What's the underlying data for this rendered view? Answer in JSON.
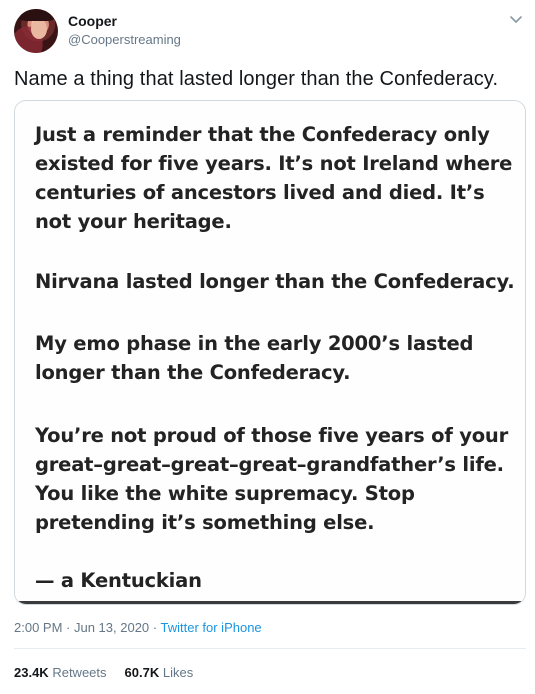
{
  "user": {
    "name": "Cooper",
    "handle": "@Cooperstreaming"
  },
  "tweet": {
    "text": "Name a thing that lasted longer than the Confederacy."
  },
  "media_text": {
    "p1": "Just a reminder that the Confederacy only existed for five years. It’s not Ireland where centuries of ancestors lived and died. It’s not your heritage.",
    "p2": "Nirvana lasted longer than the Confederacy.",
    "p3": "My emo phase in the early 2000’s lasted longer than the Confederacy.",
    "p4": "You’re not proud of those five years of your great–great–great–great–grandfather’s life. You like the white supremacy. Stop pretending it’s something else.",
    "p5": "— a Kentuckian"
  },
  "meta": {
    "time": "2:00 PM",
    "sep1": " · ",
    "date": "Jun 13, 2020",
    "sep2": " · ",
    "source": "Twitter for iPhone"
  },
  "stats": {
    "retweets_count": "23.4K",
    "retweets_label": "Retweets",
    "likes_count": "60.7K",
    "likes_label": "Likes"
  },
  "icons": {
    "menu": "chevron-down-icon"
  },
  "colors": {
    "link": "#1b95e0",
    "secondary": "#657786"
  }
}
